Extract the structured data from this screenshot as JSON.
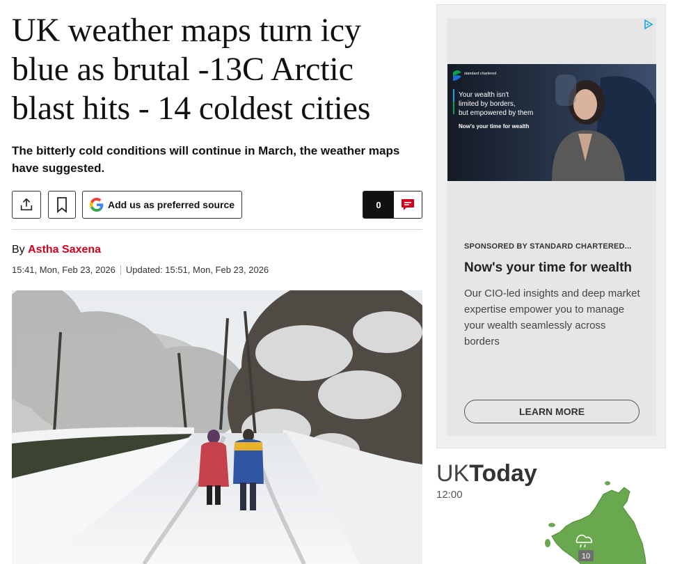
{
  "article": {
    "headline": "UK weather maps turn icy blue as brutal -13C Arctic blast hits - 14 coldest cities",
    "standfirst": "The bitterly cold conditions will continue in March, the weather maps have suggested.",
    "actions": {
      "share_icon": "share-icon",
      "bookmark_icon": "bookmark-icon",
      "google_label": "Add us as preferred source",
      "comment_count": "0"
    },
    "byline": {
      "prefix": "By",
      "author": "Astha Saxena"
    },
    "published": "15:41, Mon, Feb 23, 2026",
    "updated": "Updated: 15:51, Mon, Feb 23, 2026"
  },
  "ad": {
    "brand": "standard chartered",
    "image_text_1": "Your wealth isn't",
    "image_text_2": "limited by borders,",
    "image_text_3": "but empowered by them",
    "image_tagline": "Now's your time for wealth",
    "sponsor": "SPONSORED BY STANDARD CHARTERED...",
    "title": "Now's your time for wealth",
    "body": "Our CIO-led insights and deep market expertise empower you to manage your wealth seamlessly across borders",
    "cta": "LEARN MORE"
  },
  "weather": {
    "title_light": "UK",
    "title_bold": "Today",
    "time": "12:00",
    "temperature": "10"
  },
  "colors": {
    "accent_red": "#d1001c",
    "map_green": "#6aa84f",
    "ad_bg": "#e6e6e6"
  }
}
